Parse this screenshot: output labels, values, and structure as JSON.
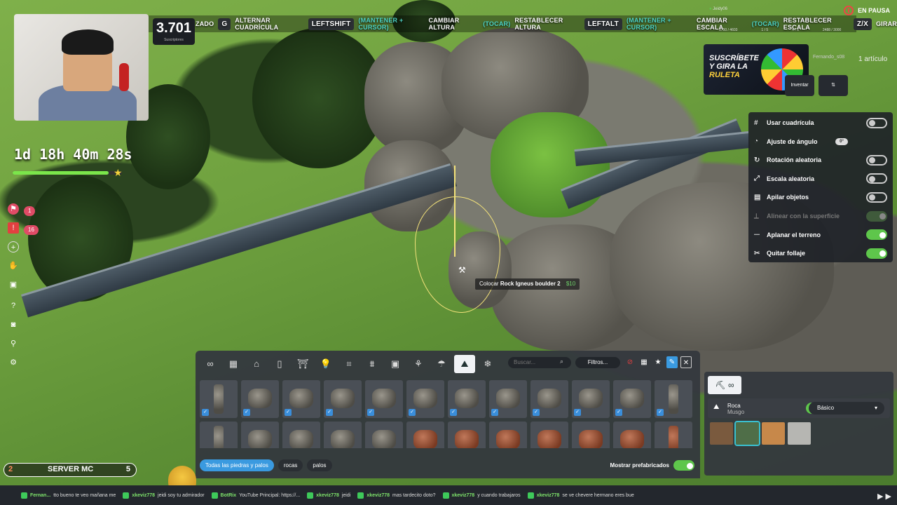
{
  "stream": {
    "subscriber_count": "3.701",
    "subscriber_label": "Suscriptores",
    "timer": "1d 18h 40m 28s",
    "timer_progress": 0.88,
    "pause_label": "EN PAUSA",
    "top_user": "Jeidy06"
  },
  "hints": {
    "left_fragment": "ZADO",
    "g_key": "G",
    "g_label": "ALTERNAR CUADRÍCULA",
    "shift_key": "LEFTSHIFT",
    "shift_hint": "(MANTENER + CURSOR)",
    "shift_label": "CAMBIAR ALTURA",
    "shift_hint2": "(TOCAR)",
    "shift_label2": "RESTABLECER ALTURA",
    "alt_key": "LEFTALT",
    "alt_hint": "(MANTENER + CURSOR)",
    "alt_label": "CAMBIAR ESCALA",
    "alt_hint2": "(TOCAR)",
    "alt_label2": "RESTABLECER ESCALA",
    "zx_key": "Z/X",
    "zx_label": "GIRAR"
  },
  "stats": {
    "a": "3700 / 4603",
    "b": "1 / 5",
    "c": "4 / 5",
    "d": "2488 / 3000"
  },
  "left_badges": {
    "pink": "1",
    "red": "16"
  },
  "shop": {
    "line1": "SUSCRÍBETE",
    "line2": "Y GIRA LA",
    "line3": "RULETA",
    "user": "Fernando_s08",
    "items": "1 artículo",
    "tool_label": "Inventar"
  },
  "settings": {
    "rows": [
      {
        "label": "Usar cuadrícula",
        "icon": "#",
        "state": "off"
      },
      {
        "label": "Ajuste de ángulo",
        "icon": "◔",
        "state": "angle",
        "value": "0°"
      },
      {
        "label": "Rotación aleatoria",
        "icon": "↻",
        "state": "off"
      },
      {
        "label": "Escala aleatoria",
        "icon": "⤢",
        "state": "off"
      },
      {
        "label": "Apilar objetos",
        "icon": "▤",
        "state": "off"
      },
      {
        "label": "Alinear con la superficie",
        "icon": "⟂",
        "state": "dimon"
      },
      {
        "label": "Aplanar el terreno",
        "icon": "⏤",
        "state": "on"
      },
      {
        "label": "Quitar follaje",
        "icon": "✂",
        "state": "on"
      }
    ]
  },
  "placement": {
    "action": "Colocar",
    "object": "Rock Igneus boulder 2",
    "price": "$10"
  },
  "builder": {
    "tabs": [
      "∞",
      "▦",
      "⌂",
      "▯",
      "⛩",
      "💡",
      "⌗",
      "⩩",
      "▣",
      "⚘",
      "☂",
      "⛰",
      "❄"
    ],
    "active_tab": 11,
    "search_placeholder": "Buscar...",
    "filter_label": "Filtros...",
    "chips": [
      "Todas las piedras y palos",
      "rocas",
      "palos"
    ],
    "prefab_label": "Mostrar prefabricados"
  },
  "material": {
    "tab_icons": "⛏ ∞",
    "name": "Roca",
    "subname": "Musgo",
    "dropdown": "Básico",
    "swatches": [
      "#7a5a3e",
      "#4f6e48",
      "#c7884a",
      "#b6b6b2"
    ]
  },
  "server": {
    "left_num": "2",
    "name": "SERVER MC",
    "right_num": "5"
  },
  "chat": [
    {
      "user": "Fernan...",
      "text": "tto bueno te veo mañana me"
    },
    {
      "user": "xkeviz778",
      "text": "jeidi soy tu admirador"
    },
    {
      "user": "BotRix",
      "text": "YouTube Principal: https://..."
    },
    {
      "user": "xkeviz778",
      "text": "jeidi"
    },
    {
      "user": "xkeviz778",
      "text": "mas tardecito doto?"
    },
    {
      "user": "xkeviz778",
      "text": "y cuando trabajaros"
    },
    {
      "user": "xkeviz778",
      "text": "se ve chevere hermano eres bue"
    }
  ]
}
